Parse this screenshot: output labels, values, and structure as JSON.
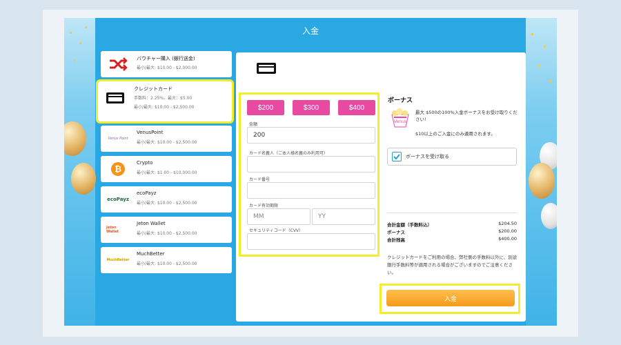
{
  "modal": {
    "title": "入金"
  },
  "methods": [
    {
      "name": "バウチャー購入 (銀行送金)",
      "line1": "最小/最大: $10.00 - $2,000.00",
      "line2": "",
      "icon": "shuffle-icon"
    },
    {
      "name": "クレジットカード",
      "line1": "手数料：2.25%，最大：$5.00",
      "line2": "最小/最大: $10.00 - $2,500.00",
      "icon": "credit-card-icon"
    },
    {
      "name": "VenusPoint",
      "line1": "最小/最大: $10.00 - $2,500.00",
      "line2": "",
      "icon": "venuspoint-logo",
      "logo_text": "Venus Point"
    },
    {
      "name": "Crypto",
      "line1": "最小/最大: $1.00 - $10,000.00",
      "line2": "",
      "icon": "bitcoin-icon"
    },
    {
      "name": "ecoPayz",
      "line1": "最小/最大: $10.00 - $2,500.00",
      "line2": "",
      "icon": "ecopayz-logo",
      "logo_text": "ecoPayz"
    },
    {
      "name": "Jeton Wallet",
      "line1": "最小/最大: $10.00 - $2,500.00",
      "line2": "",
      "icon": "jeton-logo",
      "logo_text": "Jeton Wallet"
    },
    {
      "name": "MuchBetter",
      "line1": "最小/最大: $10.00 - $2,500.00",
      "line2": "",
      "icon": "muchbetter-logo",
      "logo_text": "MuchBetter"
    }
  ],
  "form": {
    "presets": [
      "$200",
      "$300",
      "$400"
    ],
    "amount_label": "金額",
    "amount_value": "200",
    "cardholder_label": "カード名義人（ご本人様名義のみ利用可）",
    "card_number_label": "カード番号",
    "expiry_label": "カード有効期限",
    "expiry_month_placeholder": "MM",
    "expiry_year_placeholder": "YY",
    "cvv_label": "セキュリティコード（CVV）"
  },
  "bonus": {
    "title": "ボーナス",
    "image_label": "Venus",
    "description": "最大 $500の100%入金ボーナスをお受け取りください!",
    "condition": "$10以上のご入金にのみ適用されます。",
    "checkbox_label": "ボーナスを受け取る",
    "checked": true
  },
  "summary": {
    "rows": [
      {
        "key": "合計金額（手数料込）",
        "value": "$204.50"
      },
      {
        "key": "ボーナス",
        "value": "$200.00"
      },
      {
        "key": "合計残高",
        "value": "$400.00"
      }
    ],
    "note": "クレジットカードをご利用の場合、弊社側の手数料以外に、別途銀行手数料等が適用される場合がございますのでご注意ください。"
  },
  "deposit_button": "入金",
  "colors": {
    "modal_bg": "#29a8e3",
    "preset_pink": "#e84aa2",
    "highlight_yellow": "#f5ec2a",
    "deposit_orange": "#f59b1c"
  }
}
